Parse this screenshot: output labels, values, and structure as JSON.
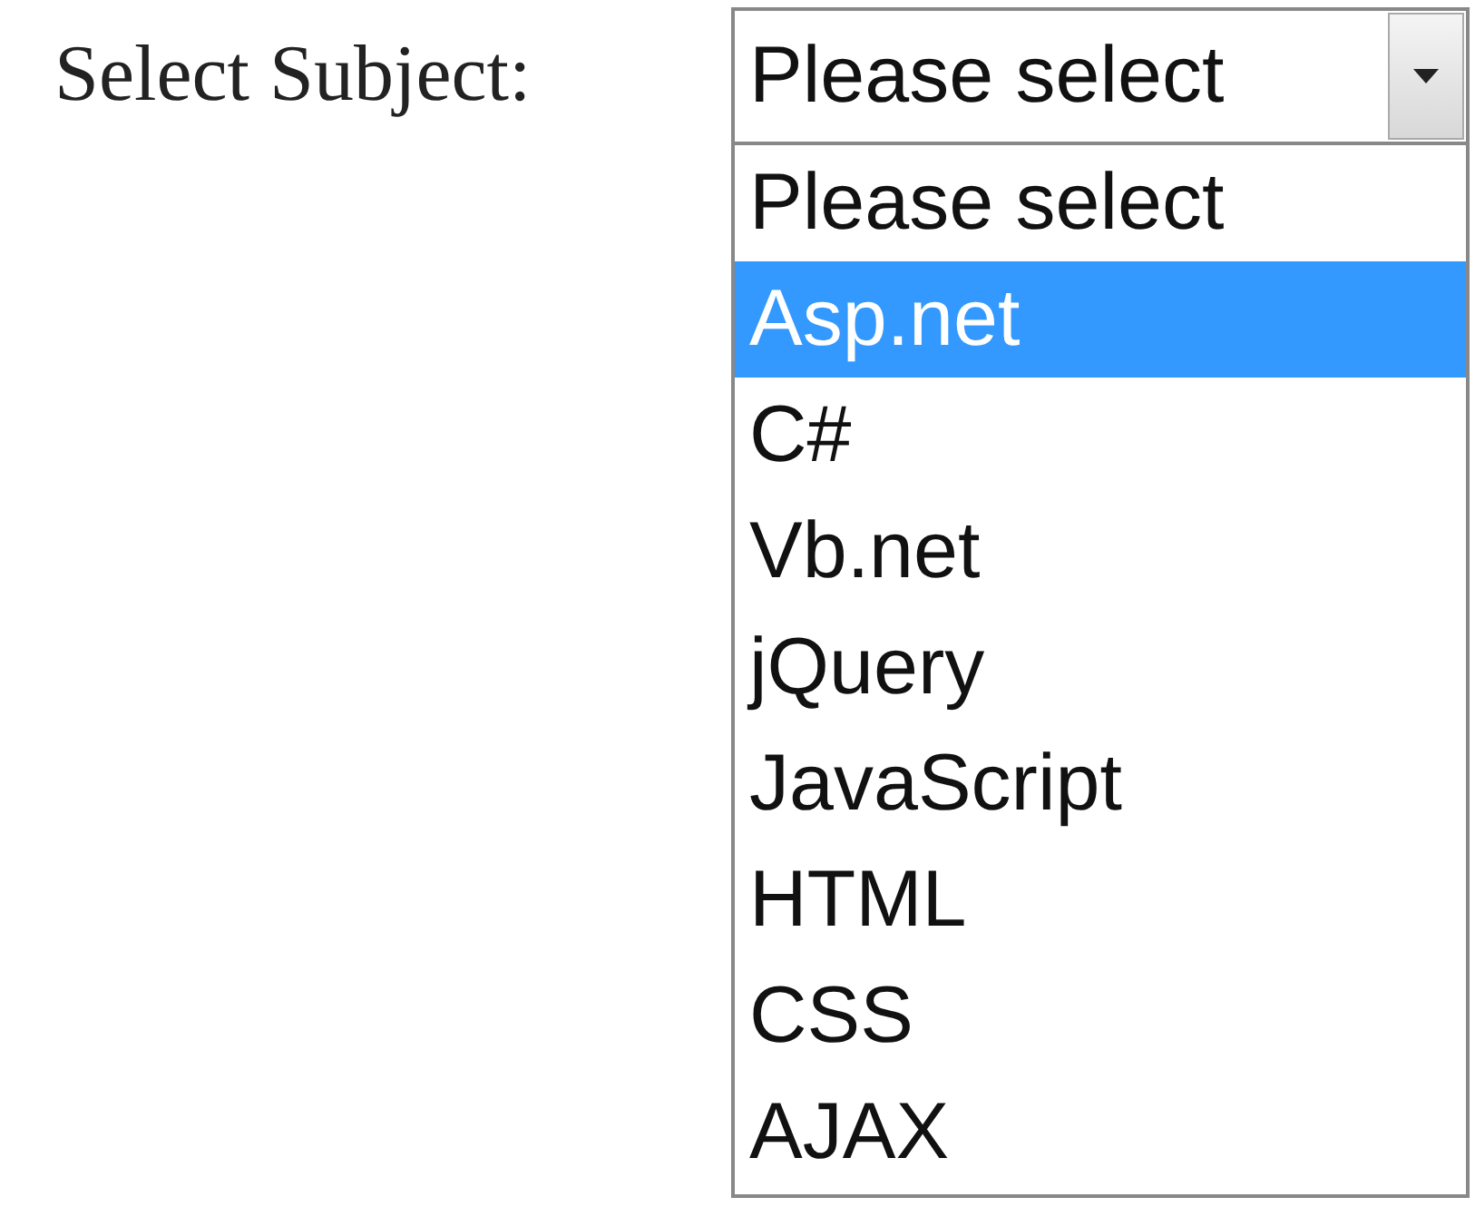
{
  "label": "Select Subject:",
  "select": {
    "value": "Please select",
    "expanded": true,
    "options": [
      {
        "label": "Please select",
        "highlighted": false
      },
      {
        "label": "Asp.net",
        "highlighted": true
      },
      {
        "label": "C#",
        "highlighted": false
      },
      {
        "label": "Vb.net",
        "highlighted": false
      },
      {
        "label": "jQuery",
        "highlighted": false
      },
      {
        "label": "JavaScript",
        "highlighted": false
      },
      {
        "label": "HTML",
        "highlighted": false
      },
      {
        "label": "CSS",
        "highlighted": false
      },
      {
        "label": "AJAX",
        "highlighted": false
      }
    ]
  }
}
